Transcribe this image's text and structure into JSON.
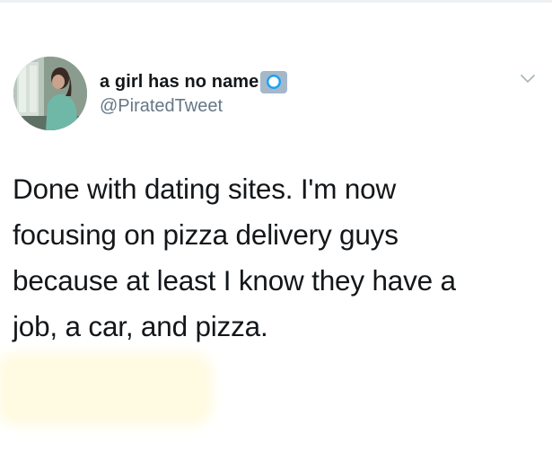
{
  "tweet": {
    "author": {
      "display_name": "a girl has no name",
      "handle": "@PiratedTweet",
      "avatar_icon": "profile-photo-woman-by-window",
      "verified_icon": "verified-badge-icon"
    },
    "menu_icon": "chevron-down-icon",
    "text_lines": [
      "Done with dating sites. I'm now",
      "focusing on pizza delivery guys",
      "because at least I know they have a",
      "job, a car, and pizza."
    ]
  },
  "colors": {
    "text_primary": "#14171a",
    "text_secondary": "#657786",
    "badge": "#a4b8ca",
    "redaction_highlight": "#fffbe3"
  }
}
